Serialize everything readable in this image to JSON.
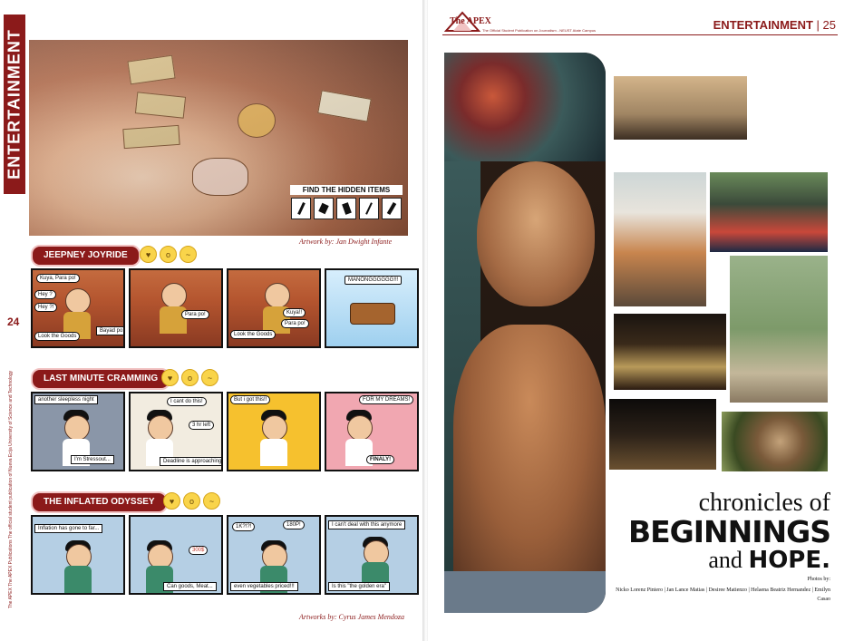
{
  "left_page": {
    "side_tab": "ENTERTAINMENT",
    "page_number": "24",
    "side_credits": "The APEX   The APEX Publications   The official student publication of Nueva Ecija University of Science and Technology",
    "hero": {
      "find_title": "FIND THE HIDDEN ITEMS",
      "credit": "Artwork by: Jan Dwight Infante"
    },
    "strips": [
      {
        "title": "JEEPNEY JOYRIDE",
        "panels": [
          {
            "bubbles": [
              "Kuya, Para po!",
              "Hey ?",
              "Hey ?!",
              "Look the Goods"
            ],
            "captions": [
              "Bayad po!"
            ]
          },
          {
            "bubbles": [
              "Para po!"
            ],
            "captions": []
          },
          {
            "bubbles": [
              "Kuya!!",
              "Para po!",
              "Look the Goods"
            ],
            "captions": []
          },
          {
            "bubbles": [
              "MANONGGGGGG!!!"
            ],
            "captions": []
          }
        ]
      },
      {
        "title": "LAST MINUTE CRAMMING",
        "panels": [
          {
            "bubbles": [],
            "captions": [
              "another sleepless night",
              "I'm Stressout..."
            ]
          },
          {
            "bubbles": [
              "I cant do this!",
              "3 hr left"
            ],
            "captions": [
              "Deadline is approaching."
            ]
          },
          {
            "bubbles": [
              "But i got this!!"
            ],
            "captions": []
          },
          {
            "bubbles": [
              "FOR MY DREAMS!",
              "FINALY!"
            ],
            "captions": []
          }
        ]
      },
      {
        "title": "THE INFLATED ODYSSEY",
        "panels": [
          {
            "bubbles": [],
            "captions": [
              "Inflation has gone to far..."
            ]
          },
          {
            "bubbles": [
              "300$"
            ],
            "captions": [
              "Can goods, Meat..."
            ]
          },
          {
            "bubbles": [
              "1K?!?!",
              "180P!"
            ],
            "captions": [
              "even vegetables priced!!!"
            ]
          },
          {
            "bubbles": [],
            "captions": [
              "I can't deal with this anymore",
              "Is this \"the golden era\""
            ]
          }
        ]
      }
    ],
    "artworks_credit": "Artworks by: Cyrus James Mendoza"
  },
  "right_page": {
    "logo": "The APEX",
    "masthead": "The Official Student Publication on Journalism - NEUST Atate Campus",
    "section": "ENTERTAINMENT",
    "page_number": "25",
    "title_line1": "chronicles of",
    "title_line2": "BEGINNINGS",
    "title_line3_a": "and",
    "title_line3_b": "HOPE.",
    "photos_label": "Photos by:",
    "photos_names": "Nicko Lorenz Piniero | Jan Lance Matias | Desiree Matienzo | Helaena Beatriz Hernandez | Emilyn Casao"
  },
  "colors": {
    "accent": "#8b1a1a",
    "emoji": "#f9d44a"
  }
}
